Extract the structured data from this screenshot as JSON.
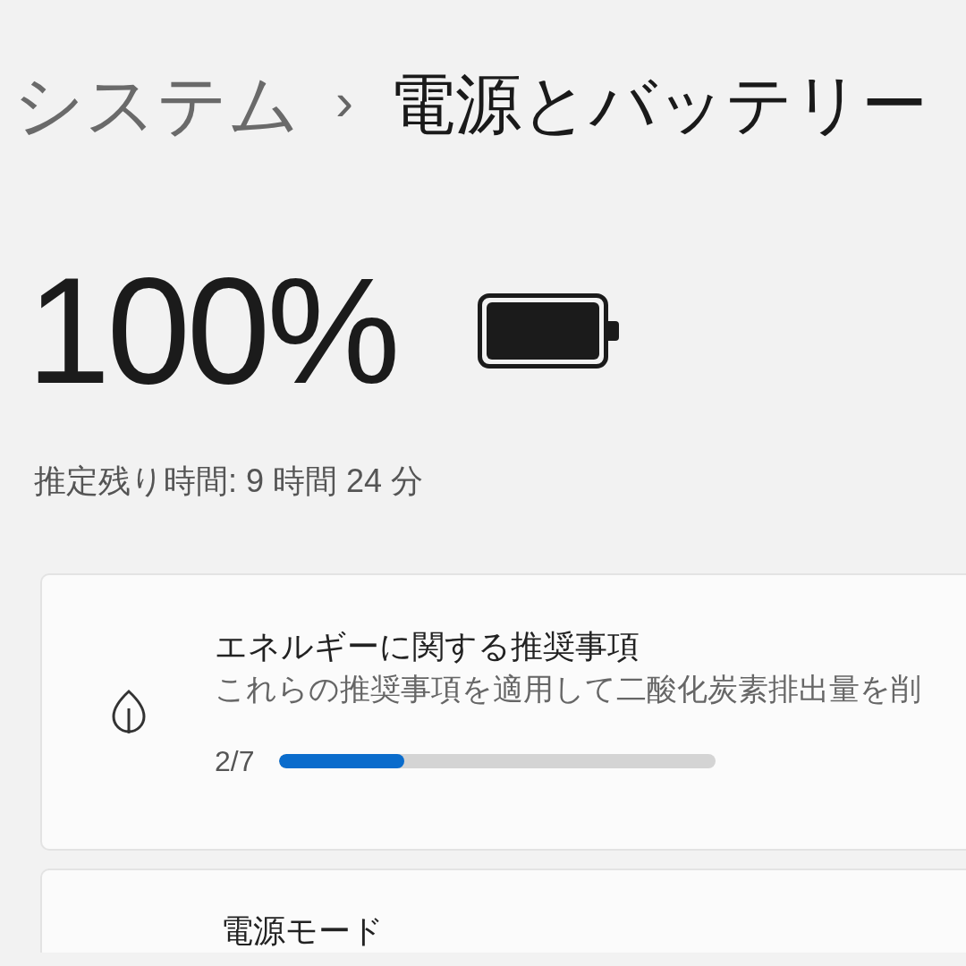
{
  "breadcrumb": {
    "parent": "システム",
    "separator": "›",
    "current": "電源とバッテリー"
  },
  "battery": {
    "percent": "100%",
    "estimate": "推定残り時間: 9 時間 24 分"
  },
  "cards": [
    {
      "kind": "recommendations",
      "title": "エネルギーに関する推奨事項",
      "subtitle": "これらの推奨事項を適用して二酸化炭素排出量を削",
      "progress_text": "2/7",
      "level": 0.2857
    },
    {
      "kind": "power_mode",
      "title": "電源モード"
    }
  ]
}
